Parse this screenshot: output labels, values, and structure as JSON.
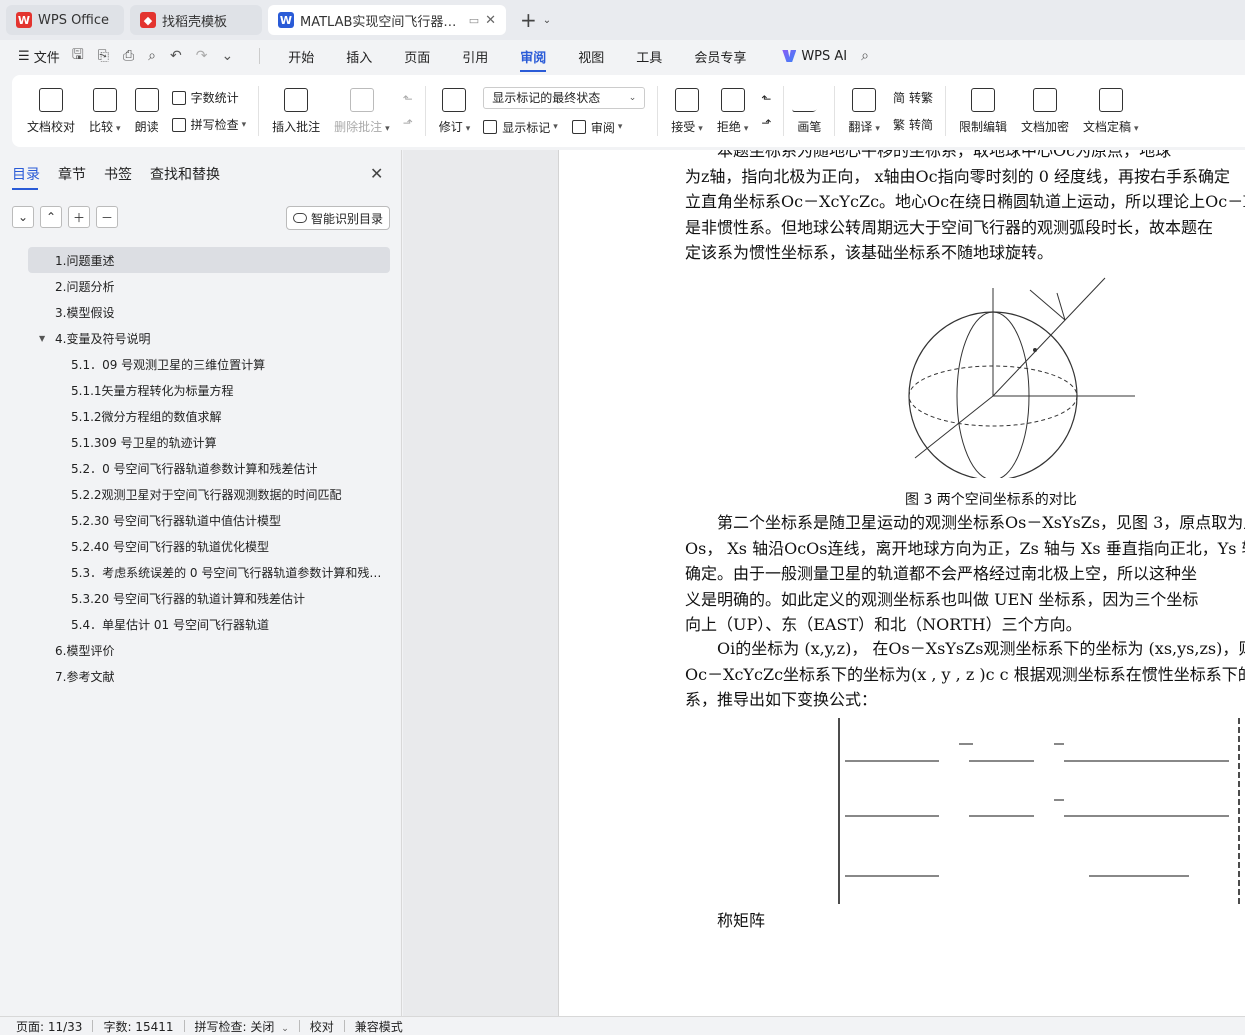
{
  "tabs": [
    {
      "label": "WPS Office",
      "icon": "wps-logo-icon"
    },
    {
      "label": "找稻壳模板",
      "icon": "docer-icon"
    },
    {
      "label": "MATLAB实现空间飞行器主动",
      "icon": "word-doc-icon"
    }
  ],
  "menubar": {
    "file": "文件",
    "nav": [
      "开始",
      "插入",
      "页面",
      "引用",
      "审阅",
      "视图",
      "工具",
      "会员专享"
    ],
    "active_nav": "审阅",
    "ai": "WPS AI"
  },
  "ribbon": {
    "proofread": "文档校对",
    "compare": "比较",
    "read_aloud": "朗读",
    "word_count": "字数统计",
    "spell_check": "拼写检查",
    "insert_comment": "插入批注",
    "delete_comment": "删除批注",
    "revise": "修订",
    "markup_dropdown": "显示标记的最终状态",
    "show_markup": "显示标记",
    "review": "审阅",
    "accept": "接受",
    "reject": "拒绝",
    "pen": "画笔",
    "translate": "翻译",
    "to_traditional": "转繁",
    "to_simplified": "转简",
    "restrict_edit": "限制编辑",
    "doc_encrypt": "文档加密",
    "doc_finalize": "文档定稿"
  },
  "sidebar": {
    "tabs": [
      "目录",
      "章节",
      "书签",
      "查找和替换"
    ],
    "smart_toc": "智能识别目录",
    "toc": [
      {
        "label": "1.问题重述",
        "level": 1,
        "selected": true
      },
      {
        "label": "2.问题分析",
        "level": 1
      },
      {
        "label": "3.模型假设",
        "level": 1
      },
      {
        "label": "4.变量及符号说明",
        "level": 1,
        "expanded": true
      },
      {
        "label": "5.1．09 号观测卫星的三维位置计算",
        "level": 2
      },
      {
        "label": "5.1.1矢量方程转化为标量方程",
        "level": 2
      },
      {
        "label": "5.1.2微分方程组的数值求解",
        "level": 2
      },
      {
        "label": "5.1.309 号卫星的轨迹计算",
        "level": 2
      },
      {
        "label": "5.2．0 号空间飞行器轨道参数计算和残差估计",
        "level": 2
      },
      {
        "label": "5.2.2观测卫星对于空间飞行器观测数据的时间匹配",
        "level": 2
      },
      {
        "label": "5.2.30 号空间飞行器轨道中值估计模型",
        "level": 2
      },
      {
        "label": "5.2.40 号空间飞行器的轨道优化模型",
        "level": 2
      },
      {
        "label": "5.3．考虑系统误差的 0 号空间飞行器轨道参数计算和残…",
        "level": 2
      },
      {
        "label": "5.3.20 号空间飞行器的轨道计算和残差估计",
        "level": 2
      },
      {
        "label": "5.4．单星估计 01 号空间飞行器轨道",
        "level": 2
      },
      {
        "label": "6.模型评价",
        "level": 1
      },
      {
        "label": "7.参考文献",
        "level": 1
      }
    ]
  },
  "document": {
    "para1": [
      "本题坐标系为随地心平移的坐标系，取地球中心Oc为原点，地球",
      "为z轴，指向北极为正向， x轴由Oc指向零时刻的 0 经度线，再按右手系确定",
      "立直角坐标系Oc－XcYcZc。地心Oc在绕日椭圆轨道上运动，所以理论上Oc－Xc",
      "是非惯性系。但地球公转周期远大于空间飞行器的观测弧段时长，故本题在",
      "定该系为惯性坐标系，该基础坐标系不随地球旋转。"
    ],
    "figure_caption": "图 3 两个空间坐标系的对比",
    "para2": [
      "第二个坐标系是随卫星运动的观测坐标系Os－XsYsZs，见图 3，原点取为卫",
      "Os， Xs 轴沿OcOs连线，离开地球方向为正，Zs 轴与 Xs 垂直指向正北，Ys 轴",
      "确定。由于一般测量卫星的轨道都不会严格经过南北极上空，所以这种坐",
      "义是明确的。如此定义的观测坐标系也叫做 UEN 坐标系，因为三个坐标",
      "向上（UP）、东（EAST）和北（NORTH）三个方向。"
    ],
    "para3": [
      "Oi的坐标为 (x,y,z)， 在Os－XsYsZs观测坐标系下的坐标为 (xs,ys,zs)，则其在",
      "Oc－XcYcZc坐标系下的坐标为(x , y , z )c c 根据观测坐标系在惯性坐标系下的投影",
      "系，推导出如下变换公式："
    ],
    "after_formula": "称矩阵"
  },
  "statusbar": {
    "page": "页面: 11/33",
    "words": "字数: 15411",
    "spell": "拼写检查: 关闭",
    "proof": "校对",
    "compat": "兼容模式"
  }
}
